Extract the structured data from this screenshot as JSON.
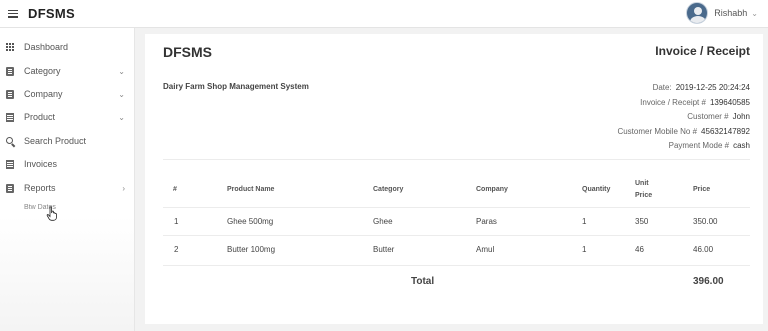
{
  "app": {
    "title": "DFSMS"
  },
  "user": {
    "name": "Rishabh"
  },
  "sidebar": {
    "items": [
      {
        "label": "Dashboard",
        "icon": "grid-icon"
      },
      {
        "label": "Category",
        "icon": "document-icon",
        "caret": "⌄"
      },
      {
        "label": "Company",
        "icon": "document-icon",
        "caret": "⌄"
      },
      {
        "label": "Product",
        "icon": "list-icon",
        "caret": "⌄"
      },
      {
        "label": "Search Product",
        "icon": "search-icon"
      },
      {
        "label": "Invoices",
        "icon": "list-icon"
      },
      {
        "label": "Reports",
        "icon": "document-icon",
        "caret": "›"
      }
    ],
    "sub_item": "Btw Dates"
  },
  "invoice": {
    "brand": "DFSMS",
    "title": "Invoice / Receipt",
    "shop_name": "Dairy Farm Shop Management System",
    "meta": {
      "date_label": "Date:",
      "date_value": "2019-12-25 20:24:24",
      "receipt_label": "Invoice / Receipt #",
      "receipt_value": "139640585",
      "customer_label": "Customer #",
      "customer_value": "John",
      "mobile_label": "Customer Mobile No #",
      "mobile_value": "45632147892",
      "payment_label": "Payment Mode #",
      "payment_value": "cash"
    },
    "table": {
      "headers": {
        "num": "#",
        "product": "Product Name",
        "category": "Category",
        "company": "Company",
        "quantity": "Quantity",
        "unit_price_1": "Unit",
        "unit_price_2": "Price",
        "price": "Price"
      },
      "rows": [
        {
          "num": "1",
          "product": "Ghee 500mg",
          "category": "Ghee",
          "company": "Paras",
          "quantity": "1",
          "unit_price": "350",
          "price": "350.00"
        },
        {
          "num": "2",
          "product": "Butter 100mg",
          "category": "Butter",
          "company": "Amul",
          "quantity": "1",
          "unit_price": "46",
          "price": "46.00"
        }
      ],
      "total_label": "Total",
      "total_value": "396.00"
    }
  }
}
